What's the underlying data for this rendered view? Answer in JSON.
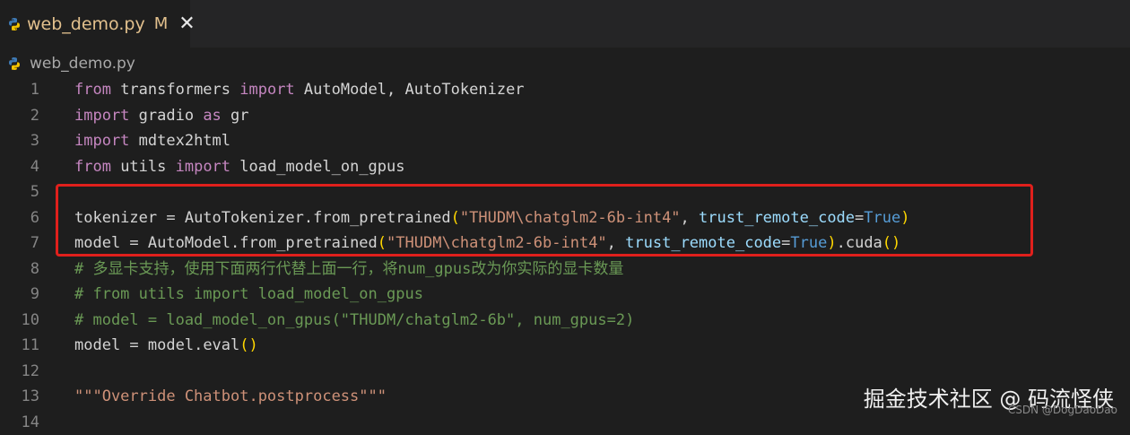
{
  "tab": {
    "title": "web_demo.py",
    "modified_marker": "M",
    "close_glyph": "✕"
  },
  "breadcrumb": {
    "file": "web_demo.py"
  },
  "lines": [
    {
      "n": "1",
      "tokens": [
        {
          "t": "from",
          "c": "kw"
        },
        {
          "t": " transformers ",
          "c": ""
        },
        {
          "t": "import",
          "c": "kw"
        },
        {
          "t": " AutoModel, AutoTokenizer",
          "c": ""
        }
      ]
    },
    {
      "n": "2",
      "tokens": [
        {
          "t": "import",
          "c": "kw"
        },
        {
          "t": " gradio ",
          "c": ""
        },
        {
          "t": "as",
          "c": "kw"
        },
        {
          "t": " gr",
          "c": ""
        }
      ]
    },
    {
      "n": "3",
      "tokens": [
        {
          "t": "import",
          "c": "kw"
        },
        {
          "t": " mdtex2html",
          "c": ""
        }
      ]
    },
    {
      "n": "4",
      "tokens": [
        {
          "t": "from",
          "c": "kw"
        },
        {
          "t": " utils ",
          "c": ""
        },
        {
          "t": "import",
          "c": "kw"
        },
        {
          "t": " load_model_on_gpus",
          "c": ""
        }
      ]
    },
    {
      "n": "5",
      "tokens": []
    },
    {
      "n": "6",
      "tokens": [
        {
          "t": "tokenizer",
          "c": ""
        },
        {
          "t": " = AutoTokenizer.",
          "c": ""
        },
        {
          "t": "from_pretrained",
          "c": ""
        },
        {
          "t": "(",
          "c": "pn"
        },
        {
          "t": "\"THUDM\\chatglm2-6b-int4\"",
          "c": "str"
        },
        {
          "t": ", ",
          "c": ""
        },
        {
          "t": "trust_remote_code",
          "c": "var"
        },
        {
          "t": "=",
          "c": ""
        },
        {
          "t": "True",
          "c": "bl"
        },
        {
          "t": ")",
          "c": "pn"
        }
      ]
    },
    {
      "n": "7",
      "tokens": [
        {
          "t": "model",
          "c": ""
        },
        {
          "t": " = AutoModel.",
          "c": ""
        },
        {
          "t": "from_pretrained",
          "c": ""
        },
        {
          "t": "(",
          "c": "pn"
        },
        {
          "t": "\"THUDM\\chatglm2-6b-int4\"",
          "c": "str"
        },
        {
          "t": ", ",
          "c": ""
        },
        {
          "t": "trust_remote_code",
          "c": "var"
        },
        {
          "t": "=",
          "c": ""
        },
        {
          "t": "True",
          "c": "bl"
        },
        {
          "t": ")",
          "c": "pn"
        },
        {
          "t": ".cuda",
          "c": ""
        },
        {
          "t": "()",
          "c": "pn"
        }
      ]
    },
    {
      "n": "8",
      "tokens": [
        {
          "t": "# 多显卡支持，使用下面两行代替上面一行，将num_gpus改为你实际的显卡数量",
          "c": "cm"
        }
      ]
    },
    {
      "n": "9",
      "tokens": [
        {
          "t": "# from utils import load_model_on_gpus",
          "c": "cm"
        }
      ]
    },
    {
      "n": "10",
      "tokens": [
        {
          "t": "# model = load_model_on_gpus(\"THUDM/chatglm2-6b\", num_gpus=2)",
          "c": "cm"
        }
      ]
    },
    {
      "n": "11",
      "tokens": [
        {
          "t": "model",
          "c": ""
        },
        {
          "t": " = model.",
          "c": ""
        },
        {
          "t": "eval",
          "c": ""
        },
        {
          "t": "()",
          "c": "pn"
        }
      ]
    },
    {
      "n": "12",
      "tokens": []
    },
    {
      "n": "13",
      "tokens": [
        {
          "t": "\"\"\"Override Chatbot.postprocess\"\"\"",
          "c": "str"
        }
      ]
    },
    {
      "n": "14",
      "tokens": []
    }
  ],
  "watermark": {
    "main": "掘金技术社区 @ 码流怪侠",
    "sub": "CSDN @DogDaoDao"
  },
  "colors": {
    "editor_bg": "#1e1e1e",
    "tabbar_bg": "#252526",
    "highlight_border": "#e0201c",
    "modified": "#e2c08d"
  },
  "icons": {
    "file_icon": "python-icon"
  }
}
